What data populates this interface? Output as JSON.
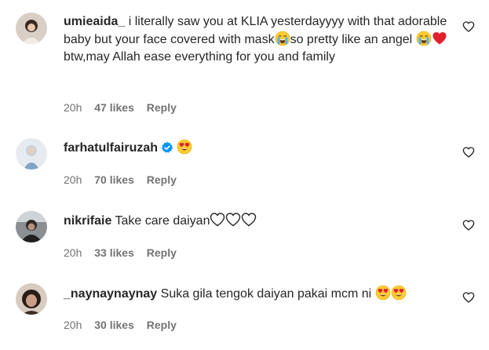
{
  "comments": [
    {
      "username": "umieaida_",
      "text_1": "i literally saw you at KLIA yesterdayyyy with that adorable baby but your face covered with mask",
      "text_2": "so pretty like an angel",
      "text_3": "btw,may Allah ease everything for you and family",
      "emojis": [
        "loudly-crying-face-emoji",
        "loudly-crying-face-emoji",
        "red-heart-emoji"
      ],
      "time": "20h",
      "likes": "47 likes",
      "reply": "Reply"
    },
    {
      "username": "farhatulfairuzah",
      "verified": true,
      "text": "",
      "emojis": [
        "heart-eyes-emoji"
      ],
      "time": "20h",
      "likes": "70 likes",
      "reply": "Reply"
    },
    {
      "username": "nikrifaie",
      "text": "Take care daiyan",
      "emojis": [
        "white-heart-emoji",
        "white-heart-emoji",
        "white-heart-emoji"
      ],
      "time": "20h",
      "likes": "33 likes",
      "reply": "Reply"
    },
    {
      "username": "_naynaynaynay",
      "text": "Suka gila tengok daiyan pakai mcm ni",
      "emojis": [
        "heart-eyes-emoji",
        "heart-eyes-emoji"
      ],
      "time": "20h",
      "likes": "30 likes",
      "reply": "Reply"
    }
  ],
  "colors": {
    "text": "#262626",
    "secondary": "#737373",
    "verified": "#0095f6"
  },
  "icons": {
    "like_button": "heart-outline-icon",
    "verified": "verified-badge-icon"
  }
}
